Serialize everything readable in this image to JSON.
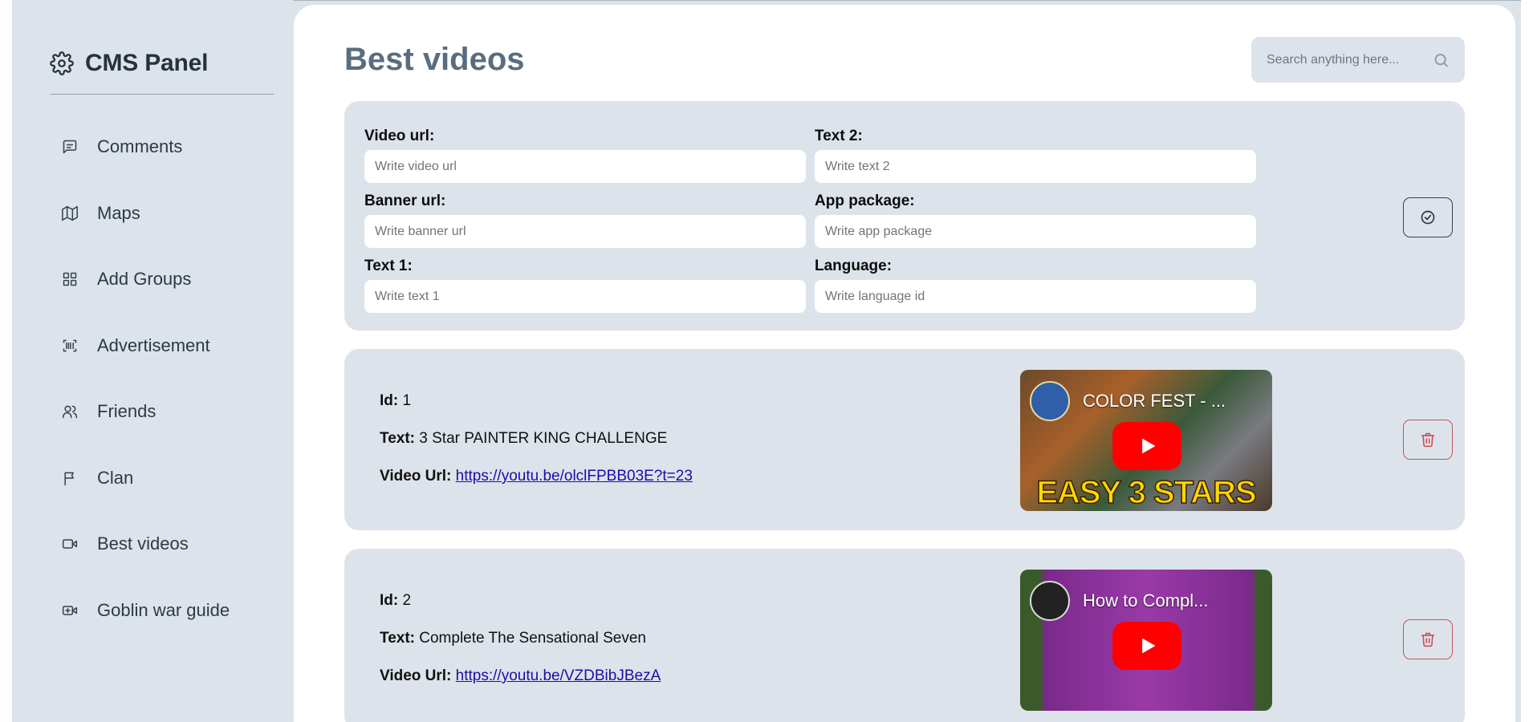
{
  "brand": {
    "title": "CMS Panel",
    "icon": "gear-icon"
  },
  "sidebar": {
    "items": [
      {
        "label": "Comments",
        "icon": "message-square-icon"
      },
      {
        "label": "Maps",
        "icon": "map-icon"
      },
      {
        "label": "Add Groups",
        "icon": "grid-icon"
      },
      {
        "label": "Advertisement",
        "icon": "barcode-icon"
      },
      {
        "label": "Friends",
        "icon": "users-icon"
      },
      {
        "label": "Clan",
        "icon": "flag-icon"
      },
      {
        "label": "Best videos",
        "icon": "video-icon"
      },
      {
        "label": "Goblin war guide",
        "icon": "video-plus-icon"
      }
    ]
  },
  "page": {
    "title": "Best videos"
  },
  "search": {
    "placeholder": "Search anything here..."
  },
  "form": {
    "video_url": {
      "label": "Video url:",
      "placeholder": "Write video url"
    },
    "text2": {
      "label": "Text 2:",
      "placeholder": "Write text 2"
    },
    "banner_url": {
      "label": "Banner url:",
      "placeholder": "Write banner url"
    },
    "app_package": {
      "label": "App package:",
      "placeholder": "Write app package"
    },
    "text1": {
      "label": "Text 1:",
      "placeholder": "Write text 1"
    },
    "language": {
      "label": "Language:",
      "placeholder": "Write language id"
    }
  },
  "videos": [
    {
      "id_label": "Id:",
      "id": "1",
      "text_label": "Text:",
      "text": "3 Star PAINTER KING CHALLENGE",
      "url_label": "Video Url:",
      "url": "https://youtu.be/olclFPBB03E?t=23",
      "thumb_title": "COLOR FEST - ...",
      "thumb_banner": "EASY 3 STARS"
    },
    {
      "id_label": "Id:",
      "id": "2",
      "text_label": "Text:",
      "text": "Complete The Sensational Seven",
      "url_label": "Video Url:",
      "url": "https://youtu.be/VZDBibJBezA",
      "thumb_title": "How to Compl...",
      "thumb_banner": ""
    }
  ],
  "colors": {
    "panel": "#dde3ea",
    "title": "#596d7f",
    "danger": "#c9484d",
    "link": "#1a0dab"
  }
}
